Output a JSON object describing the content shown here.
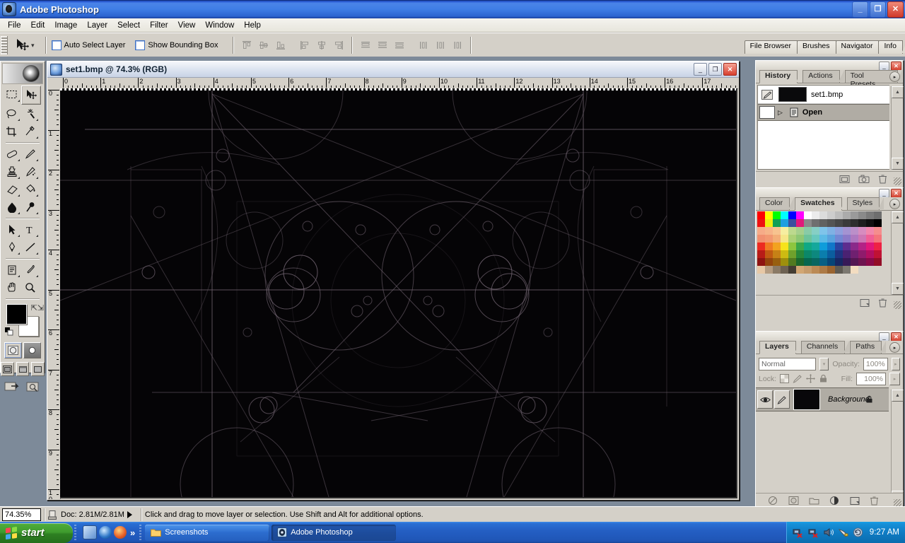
{
  "window": {
    "title": "Adobe Photoshop",
    "minimize_label": "_",
    "restore_label": "❐",
    "close_label": "✕"
  },
  "menubar": {
    "items": [
      {
        "label": "File"
      },
      {
        "label": "Edit"
      },
      {
        "label": "Image"
      },
      {
        "label": "Layer"
      },
      {
        "label": "Select"
      },
      {
        "label": "Filter"
      },
      {
        "label": "View"
      },
      {
        "label": "Window"
      },
      {
        "label": "Help"
      }
    ]
  },
  "options_bar": {
    "active_tool": "move-tool",
    "checkboxes": [
      {
        "label": "Auto Select Layer",
        "checked": false
      },
      {
        "label": "Show Bounding Box",
        "checked": false
      }
    ],
    "align_buttons": [
      "align-top-edges",
      "align-vertical-centers",
      "align-bottom-edges",
      "align-left-edges",
      "align-horizontal-centers",
      "align-right-edges"
    ],
    "distribute_buttons": [
      "distribute-top-edges",
      "distribute-vertical-centers",
      "distribute-bottom-edges",
      "distribute-left-edges",
      "distribute-horizontal-centers",
      "distribute-right-edges"
    ],
    "palette_well": [
      {
        "label": "File Browser"
      },
      {
        "label": "Brushes"
      },
      {
        "label": "Navigator"
      },
      {
        "label": "Info"
      }
    ]
  },
  "toolbox": {
    "tools": [
      {
        "name": "rectangular-marquee-tool",
        "selected": false
      },
      {
        "name": "move-tool",
        "selected": true
      },
      {
        "name": "lasso-tool",
        "selected": false
      },
      {
        "name": "magic-wand-tool",
        "selected": false
      },
      {
        "name": "crop-tool",
        "selected": false
      },
      {
        "name": "slice-tool",
        "selected": false
      },
      {
        "name": "healing-brush-tool",
        "selected": false
      },
      {
        "name": "brush-tool",
        "selected": false
      },
      {
        "name": "clone-stamp-tool",
        "selected": false
      },
      {
        "name": "history-brush-tool",
        "selected": false
      },
      {
        "name": "eraser-tool",
        "selected": false
      },
      {
        "name": "paint-bucket-tool",
        "selected": false
      },
      {
        "name": "blur-tool",
        "selected": false
      },
      {
        "name": "dodge-tool",
        "selected": false
      },
      {
        "name": "path-selection-tool",
        "selected": false
      },
      {
        "name": "type-tool",
        "selected": false
      },
      {
        "name": "pen-tool",
        "selected": false
      },
      {
        "name": "line-tool",
        "selected": false
      },
      {
        "name": "notes-tool",
        "selected": false
      },
      {
        "name": "eyedropper-tool",
        "selected": false
      },
      {
        "name": "hand-tool",
        "selected": false
      },
      {
        "name": "zoom-tool",
        "selected": false
      }
    ],
    "foreground_color": "#000000",
    "background_color": "#ffffff",
    "mask_modes": [
      "standard-mask-mode",
      "quick-mask-mode"
    ],
    "screen_modes": [
      "standard-screen-mode",
      "full-screen-with-menubar",
      "full-screen-mode"
    ],
    "jump_buttons": [
      "jump-to-imageready",
      "jump-to-editor"
    ]
  },
  "document": {
    "title": "set1.bmp @ 74.3% (RGB)",
    "minimize_label": "_",
    "maximize_label": "❐",
    "close_label": "✕",
    "h_ruler_labels": [
      "0",
      "1",
      "2",
      "3",
      "4",
      "5",
      "6",
      "7",
      "8",
      "9",
      "10",
      "11",
      "12",
      "13",
      "14",
      "15",
      "16",
      "17"
    ],
    "v_ruler_labels": [
      "0",
      "1",
      "2",
      "3",
      "4",
      "5",
      "6",
      "7",
      "8",
      "9",
      "10"
    ],
    "canvas_background": "#050406",
    "artwork_stroke": "#c9b2c7"
  },
  "history_palette": {
    "tabs": [
      {
        "label": "History",
        "active": true
      },
      {
        "label": "Actions",
        "active": false
      },
      {
        "label": "Tool Presets",
        "active": false
      }
    ],
    "snapshot": {
      "label": "set1.bmp"
    },
    "states": [
      {
        "label": "Open",
        "selected": true
      }
    ],
    "footer_buttons": [
      "create-document-from-state",
      "create-new-snapshot",
      "delete-state"
    ]
  },
  "swatches_palette": {
    "tabs": [
      {
        "label": "Color",
        "active": false
      },
      {
        "label": "Swatches",
        "active": true
      },
      {
        "label": "Styles",
        "active": false
      }
    ],
    "footer_buttons": [
      "create-new-swatch",
      "delete-swatch"
    ],
    "colors": [
      "#ff0000",
      "#ffff00",
      "#00ff00",
      "#00ffff",
      "#0000ff",
      "#ff00ff",
      "#ffffff",
      "#ececec",
      "#dcdcdc",
      "#cdcdcd",
      "#bdbdbd",
      "#ababab",
      "#9a9a9a",
      "#8a8a8a",
      "#7a7a7a",
      "#6e6e6e",
      "#ee1111",
      "#eeee11",
      "#0f9f55",
      "#1f9fe0",
      "#3a4f9e",
      "#e01a7a",
      "#8a8a8a",
      "#6f6f6f",
      "#616161",
      "#545454",
      "#474747",
      "#3a3a3a",
      "#2d2d2d",
      "#1e1e1e",
      "#101010",
      "#000000",
      "#f6ab88",
      "#f6b489",
      "#f7c38f",
      "#f6eea0",
      "#bcd98e",
      "#a5cf8c",
      "#88cba7",
      "#86cfc5",
      "#7fc4ea",
      "#7fb1e4",
      "#8f9fdd",
      "#a493d2",
      "#bb8fc9",
      "#d78cbf",
      "#f287ac",
      "#f58d8d",
      "#f19070",
      "#f29972",
      "#f3ae78",
      "#f6e688",
      "#abd177",
      "#8fc774",
      "#6dc39b",
      "#68c8bd",
      "#5cbae6",
      "#5aa3de",
      "#7388d4",
      "#8c7ac8",
      "#ae79c0",
      "#cd76b4",
      "#f05f96",
      "#f4747b",
      "#ec2a21",
      "#ef7a22",
      "#f2a220",
      "#f7e31b",
      "#8dc63f",
      "#3aa74a",
      "#0fa884",
      "#14a89c",
      "#0f9ddb",
      "#1177c9",
      "#2a43a0",
      "#5d2d8f",
      "#8a2a8a",
      "#b32286",
      "#e0167a",
      "#ee2144",
      "#b81c17",
      "#c05a12",
      "#c68116",
      "#cdbb12",
      "#6fa12c",
      "#27873a",
      "#0b8768",
      "#0d887e",
      "#0b7ead",
      "#0b5d9e",
      "#1f3380",
      "#4a2272",
      "#6f2070",
      "#8f1b6c",
      "#b20f61",
      "#c01234",
      "#8e1311",
      "#93440d",
      "#985f0f",
      "#9e8f0d",
      "#527a20",
      "#1c672c",
      "#07664f",
      "#086660",
      "#075f84",
      "#064577",
      "#172762",
      "#371957",
      "#551753",
      "#6e1450",
      "#880a49",
      "#930d27",
      "#e7c8a6",
      "#b49c82",
      "#8a7a66",
      "#6d6152",
      "#443d33",
      "#d2a774",
      "#c59b6b",
      "#bb8a55",
      "#ad7a45",
      "#9a6430",
      "#5e5a52",
      "#7c7870",
      "#f3dcc0"
    ]
  },
  "layers_palette": {
    "tabs": [
      {
        "label": "Layers",
        "active": true
      },
      {
        "label": "Channels",
        "active": false
      },
      {
        "label": "Paths",
        "active": false
      }
    ],
    "blend_mode": "Normal",
    "opacity_label": "Opacity:",
    "opacity_value": "100%",
    "lock_label": "Lock:",
    "fill_label": "Fill:",
    "fill_value": "100%",
    "lock_buttons": [
      "lock-transparent-pixels",
      "lock-image-pixels",
      "lock-position",
      "lock-all"
    ],
    "layers": [
      {
        "name": "Background",
        "visible": true,
        "locked": true,
        "selected": true
      }
    ],
    "footer_buttons": [
      "add-layer-style",
      "add-layer-mask",
      "create-new-group",
      "create-adjustment-layer",
      "create-new-layer",
      "delete-layer"
    ]
  },
  "status_bar": {
    "zoom": "74.35%",
    "doc_info": "Doc: 2.81M/2.81M",
    "hint": "Click and drag to move layer or selection.  Use Shift and Alt for additional options."
  },
  "taskbar": {
    "start_label": "start",
    "quick_launch": [
      "show-desktop-icon",
      "media-player-icon",
      "firefox-icon"
    ],
    "quick_launch_overflow": "»",
    "tasks": [
      {
        "label": "Screenshots",
        "icon": "folder-icon",
        "active": false
      },
      {
        "label": "Adobe Photoshop",
        "icon": "photoshop-icon",
        "active": true
      }
    ],
    "tray_icons": [
      "network-disconnected-icon",
      "network-disconnected-icon",
      "volume-icon",
      "dialup-icon",
      "updates-icon"
    ],
    "clock": "9:27 AM"
  }
}
